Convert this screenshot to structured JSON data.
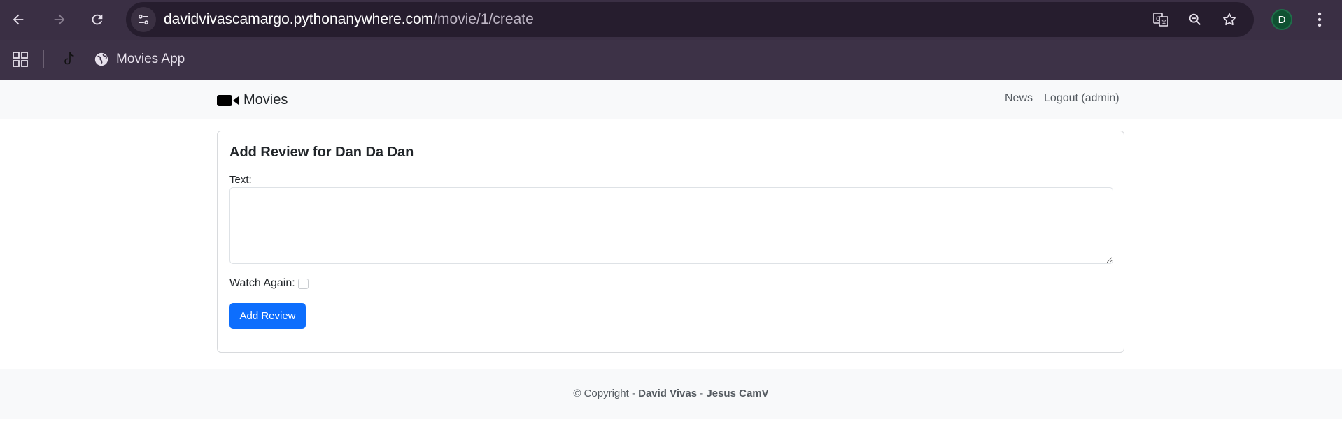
{
  "browser": {
    "url_domain": "davidvivascamargo.pythonanywhere.com",
    "url_path": "/movie/1/create",
    "profile_initial": "D",
    "icons": {
      "back": "back-arrow-icon",
      "forward": "forward-arrow-icon",
      "reload": "reload-icon",
      "site_info": "site-info-icon",
      "translate": "translate-icon",
      "zoom": "zoom-out-icon",
      "bookmark": "star-icon",
      "menu": "kebab-menu-icon"
    },
    "bookmarks": {
      "apps_icon": "apps-grid-icon",
      "tiktok_icon": "tiktok-icon",
      "movies_label": "Movies App",
      "movies_icon": "globe-icon"
    }
  },
  "navbar": {
    "brand_label": "Movies",
    "brand_icon": "video-camera-icon",
    "links": [
      "News",
      "Logout (admin)"
    ]
  },
  "form": {
    "title": "Add Review for Dan Da Dan",
    "text_label": "Text:",
    "text_value": "",
    "watch_again_label": "Watch Again:",
    "watch_again_checked": false,
    "submit_label": "Add Review"
  },
  "footer": {
    "prefix": "© Copyright - ",
    "author1": "David Vivas",
    "separator": " - ",
    "author2": "Jesus CamV"
  },
  "colors": {
    "chrome": "#3a2f44",
    "omnibox": "#261d2e",
    "primary": "#0d6efd",
    "navbar_bg": "#f8f9fa"
  }
}
